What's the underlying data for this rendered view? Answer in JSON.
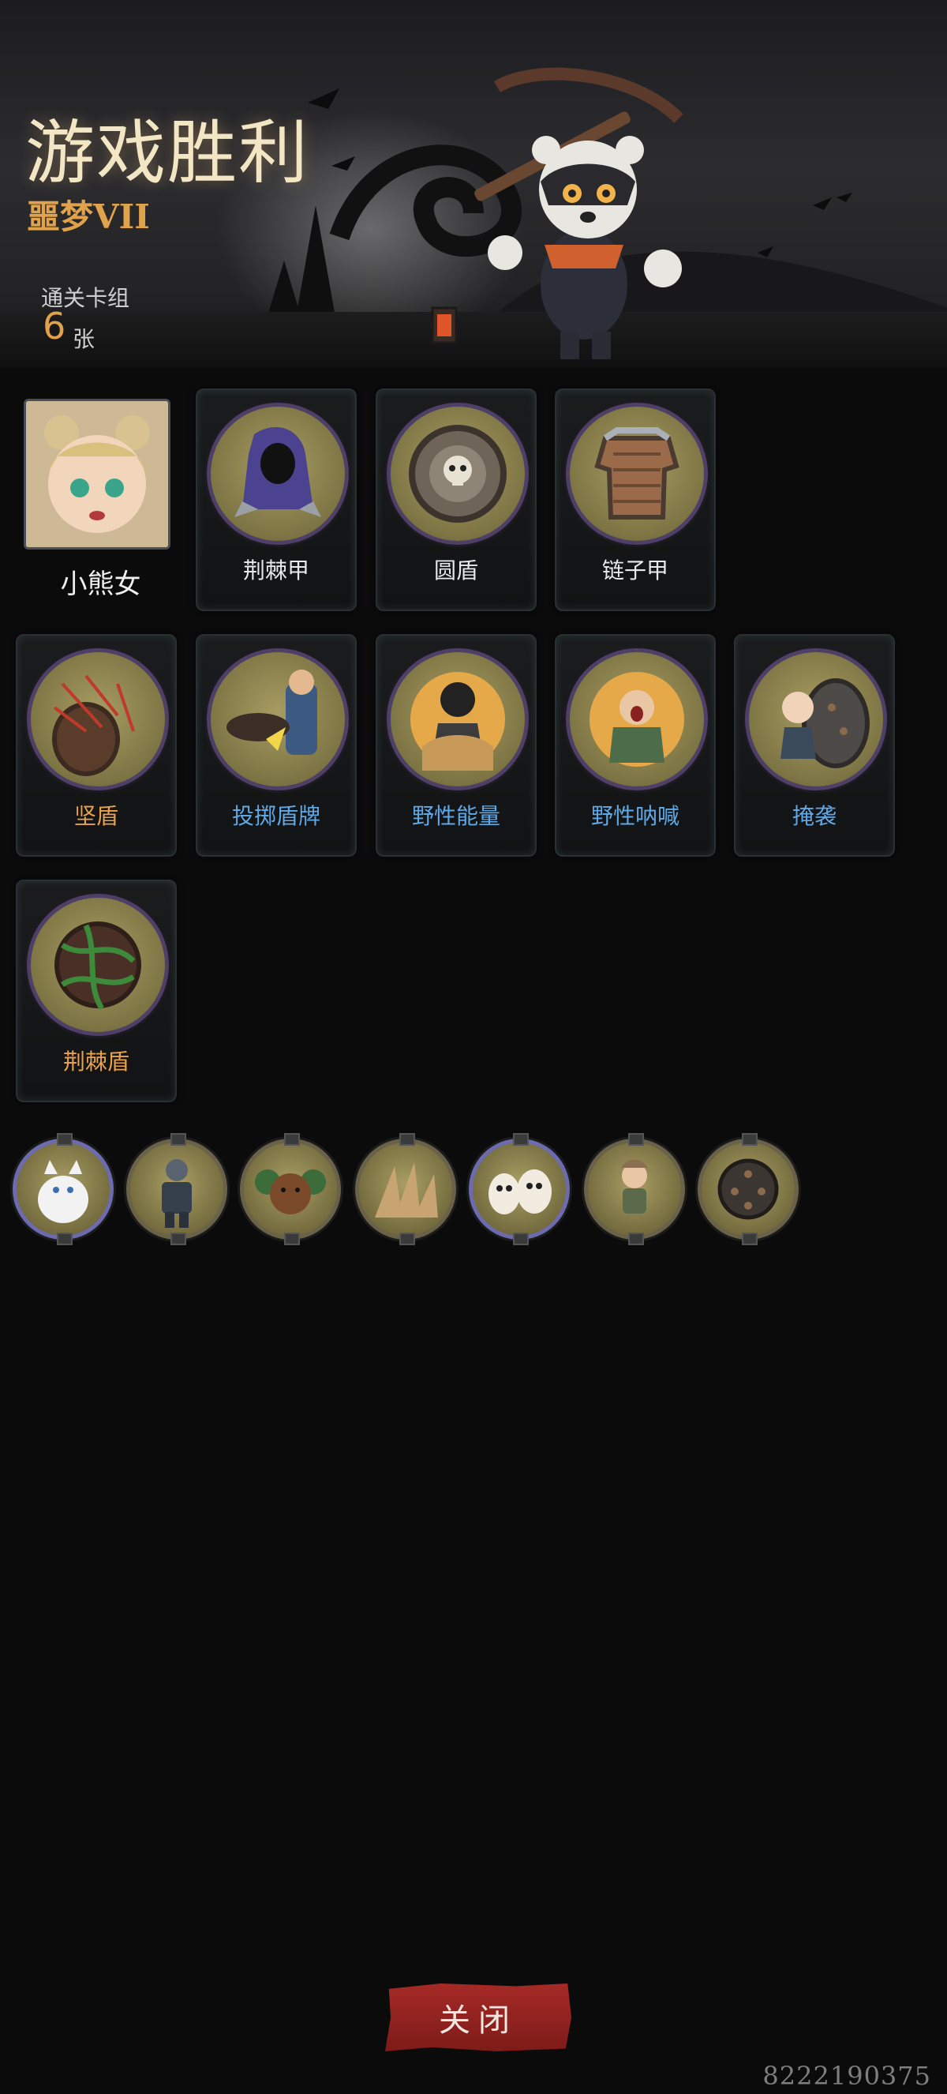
{
  "header": {
    "title": "游戏胜利",
    "difficulty": "噩梦VII",
    "deck_label": "通关卡组",
    "deck_count": "6",
    "deck_unit": "张"
  },
  "hero": {
    "name": "小熊女"
  },
  "cards": [
    {
      "name": "荆棘甲",
      "label_color": "white",
      "icon": "hooded-cloak-icon"
    },
    {
      "name": "圆盾",
      "label_color": "white",
      "icon": "skull-shield-icon"
    },
    {
      "name": "链子甲",
      "label_color": "white",
      "icon": "chainmail-icon"
    },
    {
      "name": "坚盾",
      "label_color": "orange",
      "icon": "arrow-shield-icon"
    },
    {
      "name": "投掷盾牌",
      "label_color": "blue",
      "icon": "throw-shield-icon"
    },
    {
      "name": "野性能量",
      "label_color": "blue",
      "icon": "wild-energy-icon"
    },
    {
      "name": "野性呐喊",
      "label_color": "blue",
      "icon": "wild-shout-icon"
    },
    {
      "name": "掩袭",
      "label_color": "blue",
      "icon": "ambush-icon"
    },
    {
      "name": "荆棘盾",
      "label_color": "orange",
      "icon": "thorn-shield-icon"
    }
  ],
  "relics": [
    {
      "icon": "white-cat-relic-icon",
      "rare": true
    },
    {
      "icon": "armored-knight-relic-icon",
      "rare": false
    },
    {
      "icon": "bear-relic-icon",
      "rare": false
    },
    {
      "icon": "spikes-relic-icon",
      "rare": false
    },
    {
      "icon": "owls-relic-icon",
      "rare": true
    },
    {
      "icon": "girl-relic-icon",
      "rare": false
    },
    {
      "icon": "spiked-shield-relic-icon",
      "rare": false
    }
  ],
  "close_button": {
    "label": "关闭"
  },
  "watermark": "8222190375",
  "colors": {
    "accent_orange": "#e0a24a",
    "accent_blue": "#5fa8e6",
    "close_red": "#a62a26"
  }
}
